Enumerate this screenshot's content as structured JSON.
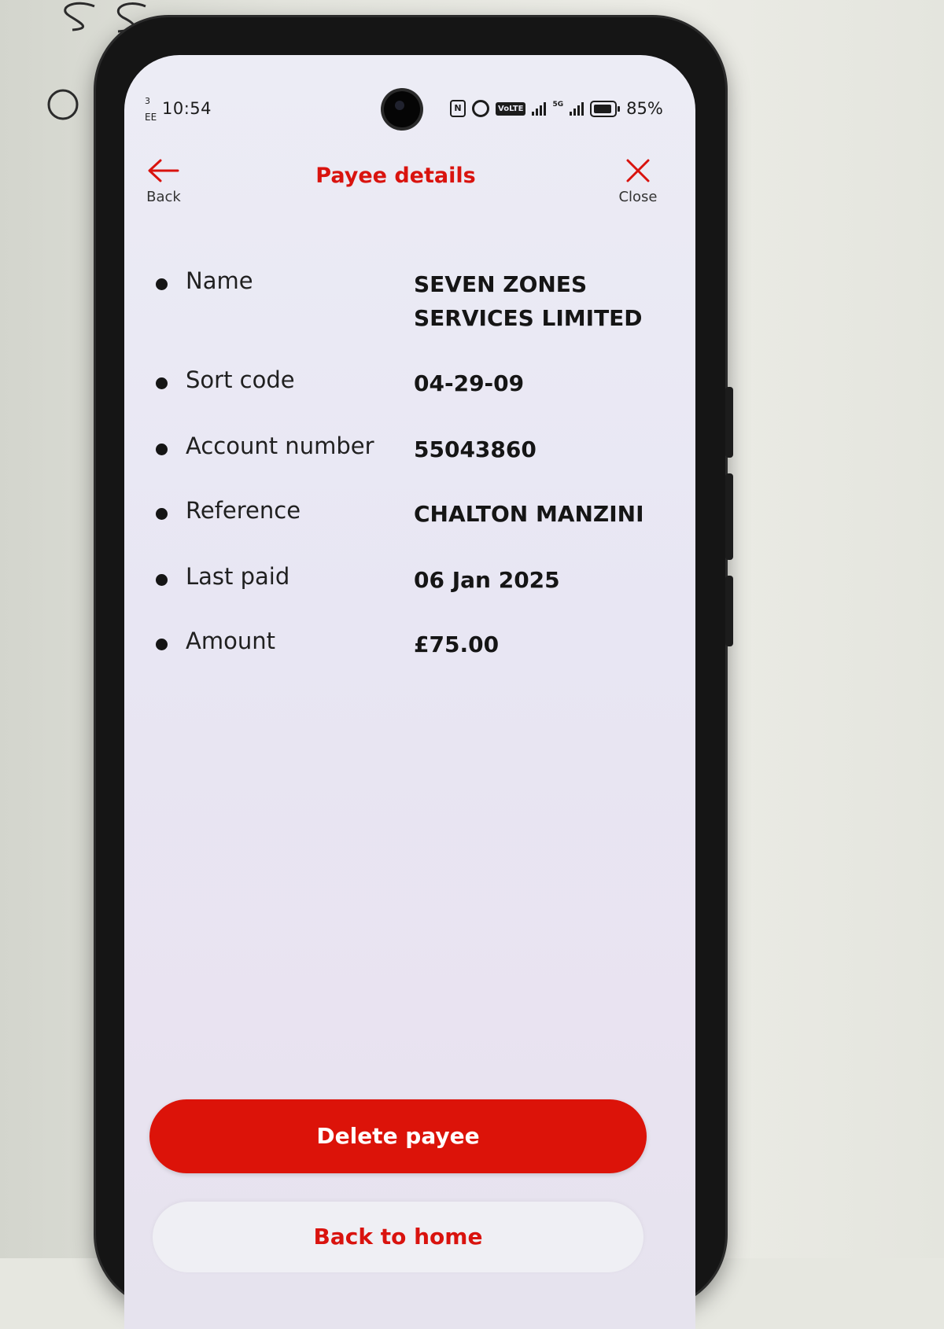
{
  "status_bar": {
    "carrier_top": "3",
    "carrier": "EE",
    "time": "10:54",
    "volte": "VoLTE",
    "network": "5G",
    "battery": "85%"
  },
  "header": {
    "back_label": "Back",
    "title": "Payee details",
    "close_label": "Close"
  },
  "details": [
    {
      "label": "Name",
      "value": "SEVEN ZONES SERVICES LIMITED"
    },
    {
      "label": "Sort code",
      "value": "04-29-09"
    },
    {
      "label": "Account number",
      "value": "55043860"
    },
    {
      "label": "Reference",
      "value": "CHALTON MANZINI"
    },
    {
      "label": "Last paid",
      "value": "06 Jan 2025"
    },
    {
      "label": "Amount",
      "value": "£75.00"
    }
  ],
  "actions": {
    "delete_label": "Delete payee",
    "home_label": "Back to home"
  },
  "colors": {
    "brand_red": "#dc1309",
    "title_red": "#d9130e"
  },
  "icons": [
    "back-arrow-icon",
    "close-x-icon",
    "nfc-icon",
    "alarm-icon",
    "signal-icon",
    "battery-icon"
  ]
}
